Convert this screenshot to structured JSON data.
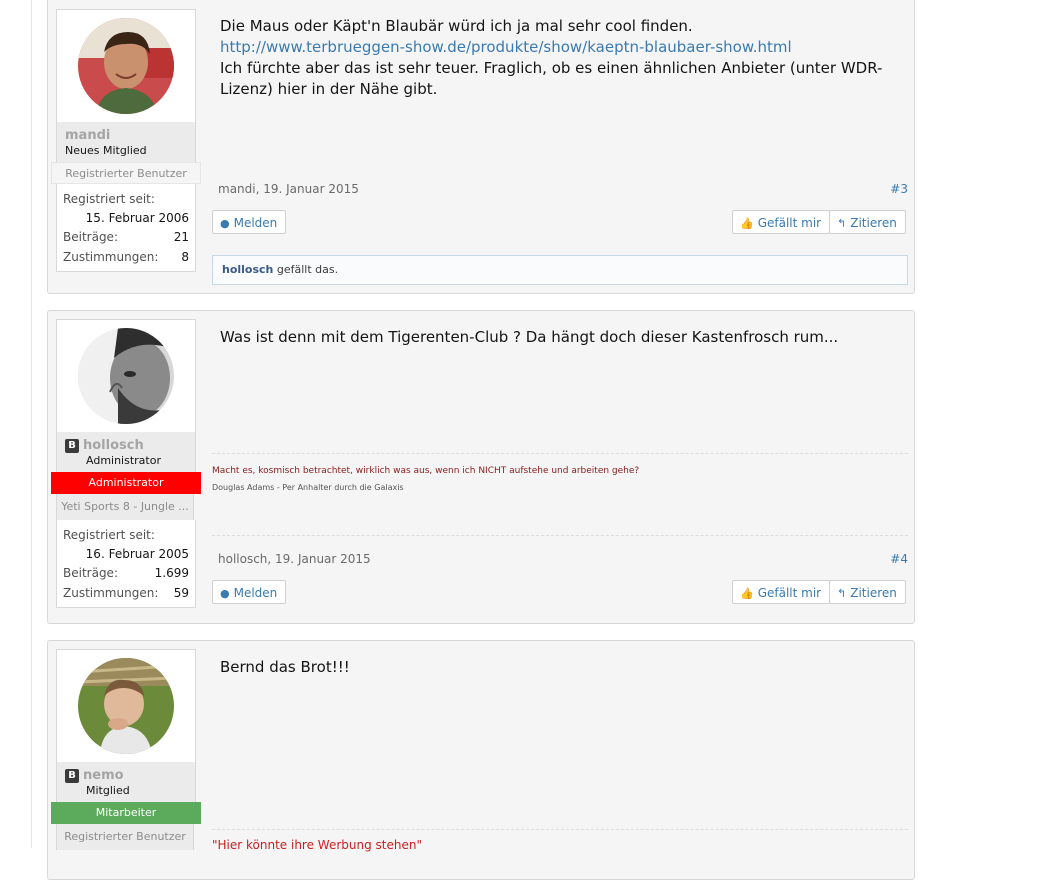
{
  "posts": [
    {
      "username": "mandi",
      "user_title": "Neues Mitglied",
      "rank": "Registrierter Benutzer",
      "reg_label": "Registriert seit:",
      "reg_date": "15. Februar 2006",
      "posts_label": "Beiträge:",
      "posts_count": "21",
      "likes_label": "Zustimmungen:",
      "likes_count": "8",
      "message_line1": "Die Maus oder Käpt'n Blaubär würd ich ja mal sehr cool finden.",
      "message_link": "http://www.terbrueggen-show.de/produkte/show/kaeptn-blaubaer-show.html",
      "message_line3": "Ich fürchte aber das ist sehr teuer. Fraglich, ob es einen ähnlichen Anbieter (unter WDR-Lizenz) hier in der Nähe gibt.",
      "meta": "mandi, 19. Januar 2015",
      "post_num": "#3",
      "report": "Melden",
      "like": "Gefällt mir",
      "quote": "Zitieren",
      "liked_by": "hollosch",
      "liked_text": "gefällt das."
    },
    {
      "username": "hollosch",
      "user_badge": "B",
      "user_title": "Administrator",
      "rank": "Administrator",
      "rank2": "Yeti Sports 8 - Jungle ...",
      "reg_label": "Registriert seit:",
      "reg_date": "16. Februar 2005",
      "posts_label": "Beiträge:",
      "posts_count": "1.699",
      "likes_label": "Zustimmungen:",
      "likes_count": "59",
      "message": "Was ist denn mit dem Tigerenten-Club ? Da hängt doch dieser Kastenfrosch rum...",
      "signature_quote": "Macht es, kosmisch betrachtet, wirklich was aus, wenn ich NICHT aufstehe und arbeiten gehe?",
      "signature_source": "Douglas Adams - Per Anhalter durch die Galaxis",
      "meta": "hollosch, 19. Januar 2015",
      "post_num": "#4",
      "report": "Melden",
      "like": "Gefällt mir",
      "quote": "Zitieren"
    },
    {
      "username": "nemo",
      "user_badge": "B",
      "user_title": "Mitglied",
      "rank": "Mitarbeiter",
      "rank2": "Registrierter Benutzer",
      "message": "Bernd das Brot!!!",
      "signature_quote": "\"Hier könnte ihre Werbung stehen\""
    }
  ],
  "colors": {
    "link": "#3a7ab0",
    "admin_rank": "#ff0000",
    "staff_rank": "#5cab5c"
  }
}
